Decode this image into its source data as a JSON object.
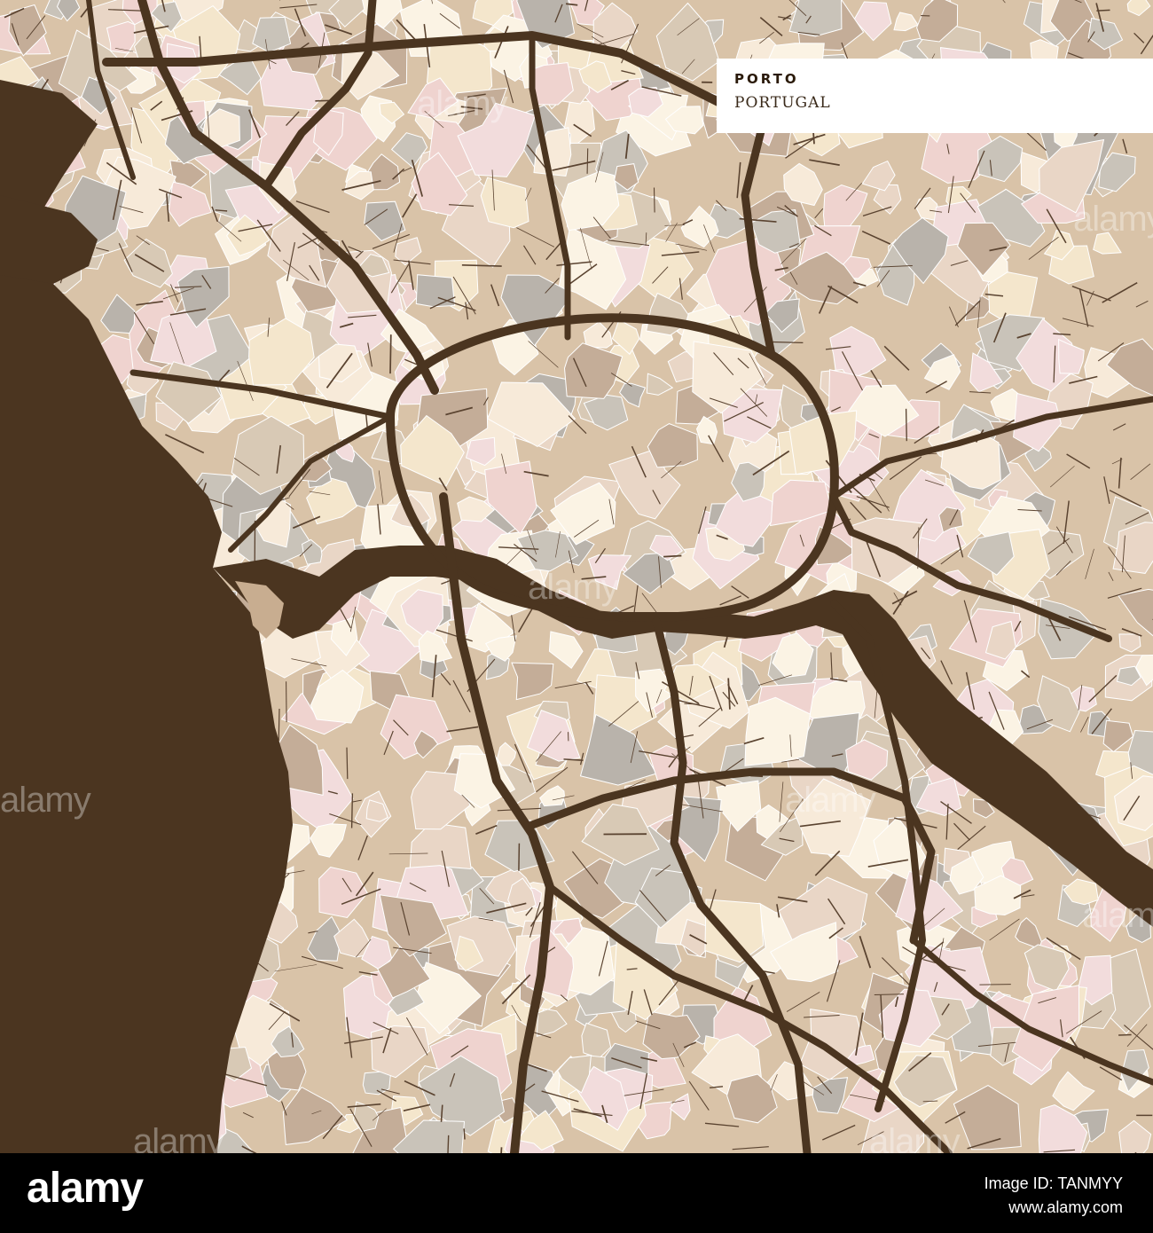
{
  "map": {
    "city": "PORTO",
    "country": "PORTUGAL",
    "colors": {
      "sea": "#4b3520",
      "river": "#4b3520",
      "land_base": "#d9c3a8",
      "roads": "#4b3520",
      "streets": "#5a4330",
      "block_palette": [
        "#f2dcdc",
        "#e9d6c6",
        "#c9c3b9",
        "#f4e6cc",
        "#fbf3e4",
        "#c4ad98",
        "#efd3cf",
        "#d8c9b5",
        "#b9b3ab",
        "#f7ead9"
      ]
    }
  },
  "watermarks": [
    "alamy",
    "alamy",
    "alamy",
    "alamy",
    "alamy",
    "alamy",
    "alamy",
    "alamy"
  ],
  "footer": {
    "logo": "alamy",
    "image_id": "Image ID: TANMYY",
    "url": "www.alamy.com"
  }
}
